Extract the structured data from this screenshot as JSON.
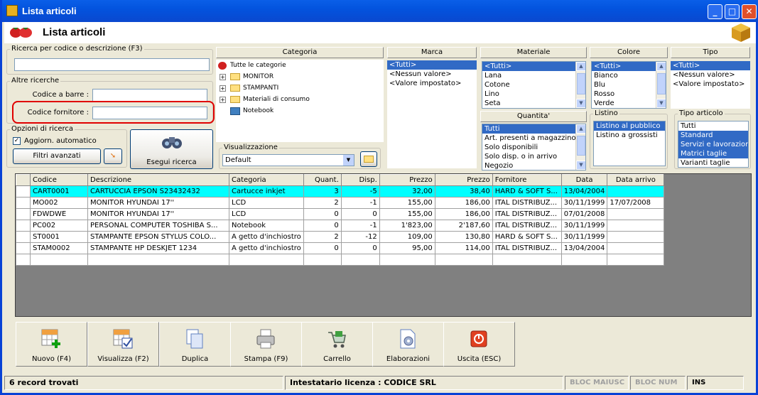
{
  "window": {
    "title": "Lista articoli",
    "header": "Lista articoli"
  },
  "search": {
    "label": "Ricerca per codice o descrizione (F3)",
    "value": ""
  },
  "other": {
    "legend": "Altre ricerche",
    "barcode_label": "Codice a barre :",
    "supplier_label": "Codice fornitore :"
  },
  "options": {
    "legend": "Opzioni di ricerca",
    "auto_label": "Aggiorn. automatico",
    "filters_label": "Filtri avanzati",
    "search_btn": "Esegui ricerca"
  },
  "category": {
    "header": "Categoria",
    "items": [
      {
        "label": "Tutte le categorie"
      },
      {
        "label": "MONITOR"
      },
      {
        "label": "STAMPANTI"
      },
      {
        "label": "Materiali di consumo"
      },
      {
        "label": "Notebook"
      }
    ]
  },
  "view": {
    "legend": "Visualizzazione",
    "value": "Default"
  },
  "marca": {
    "header": "Marca",
    "items": [
      "<Tutti>",
      "<Nessun valore>",
      "<Valore impostato>"
    ]
  },
  "materiale": {
    "header": "Materiale",
    "items": [
      "<Tutti>",
      "Lana",
      "Cotone",
      "Lino",
      "Seta"
    ]
  },
  "colore": {
    "header": "Colore",
    "items": [
      "<Tutti>",
      "Bianco",
      "Blu",
      "Rosso",
      "Verde"
    ]
  },
  "tipo": {
    "header": "Tipo",
    "items": [
      "<Tutti>",
      "<Nessun valore>",
      "<Valore impostato>"
    ]
  },
  "quantita": {
    "header": "Quantita'",
    "items": [
      "Tutti",
      "Art. presenti a magazzino",
      "Solo disponibili",
      "Solo disp. o in arrivo",
      "Negozio"
    ]
  },
  "listino": {
    "legend": "Listino",
    "items": [
      "Listino al pubblico",
      "Listino a grossisti"
    ]
  },
  "tipo_art": {
    "legend": "Tipo articolo",
    "items": [
      "Tutti",
      "Standard",
      "Servizi e lavorazioni",
      "Matrici taglie",
      "Varianti taglie"
    ]
  },
  "table": {
    "columns": [
      "Codice",
      "Descrizione",
      "Categoria",
      "Quant.",
      "Disp.",
      "Prezzo",
      "Prezzo",
      "Fornitore",
      "Data",
      "Data arrivo"
    ],
    "rows": [
      [
        "CART0001",
        "CARTUCCIA EPSON S23432432",
        "Cartucce inkjet",
        "3",
        "-5",
        "32,00",
        "38,40",
        "HARD & SOFT S...",
        "13/04/2004",
        ""
      ],
      [
        "MO002",
        "MONITOR HYUNDAI 17''",
        "LCD",
        "2",
        "-1",
        "155,00",
        "186,00",
        "ITAL DISTRIBUZ...",
        "30/11/1999",
        "17/07/2008"
      ],
      [
        "FDWDWE",
        "MONITOR HYUNDAI 17''",
        "LCD",
        "0",
        "0",
        "155,00",
        "186,00",
        "ITAL DISTRIBUZ...",
        "07/01/2008",
        ""
      ],
      [
        "PC002",
        "PERSONAL COMPUTER TOSHIBA S...",
        "Notebook",
        "0",
        "-1",
        "1'823,00",
        "2'187,60",
        "ITAL DISTRIBUZ...",
        "30/11/1999",
        ""
      ],
      [
        "ST0001",
        "STAMPANTE EPSON STYLUS COLO...",
        "A getto d'inchiostro",
        "2",
        "-12",
        "109,00",
        "130,80",
        "HARD & SOFT S...",
        "30/11/1999",
        ""
      ],
      [
        "STAM0002",
        "STAMPANTE HP DESKJET 1234",
        "A getto d'inchiostro",
        "0",
        "0",
        "95,00",
        "114,00",
        "ITAL DISTRIBUZ...",
        "13/04/2004",
        ""
      ]
    ]
  },
  "toolbar": [
    {
      "label": "Nuovo (F4)",
      "icon": "new-grid-icon"
    },
    {
      "label": "Visualizza (F2)",
      "icon": "view-grid-icon"
    },
    {
      "label": "Duplica",
      "icon": "duplicate-icon"
    },
    {
      "label": "Stampa (F9)",
      "icon": "printer-icon"
    },
    {
      "label": "Carrello",
      "icon": "cart-icon"
    },
    {
      "label": "Elaborazioni",
      "icon": "process-icon"
    },
    {
      "label": "Uscita (ESC)",
      "icon": "exit-icon"
    }
  ],
  "status": {
    "records": "6 record trovati",
    "license": "Intestatario licenza : CODICE SRL",
    "caps": "BLOC MAIUSC",
    "num": "BLOC NUM",
    "ins": "INS"
  },
  "colors": {
    "highlight": "#00ffff",
    "selection": "#316ac5",
    "titlebar": "#0a5fe8",
    "annotation": "#e00000"
  }
}
